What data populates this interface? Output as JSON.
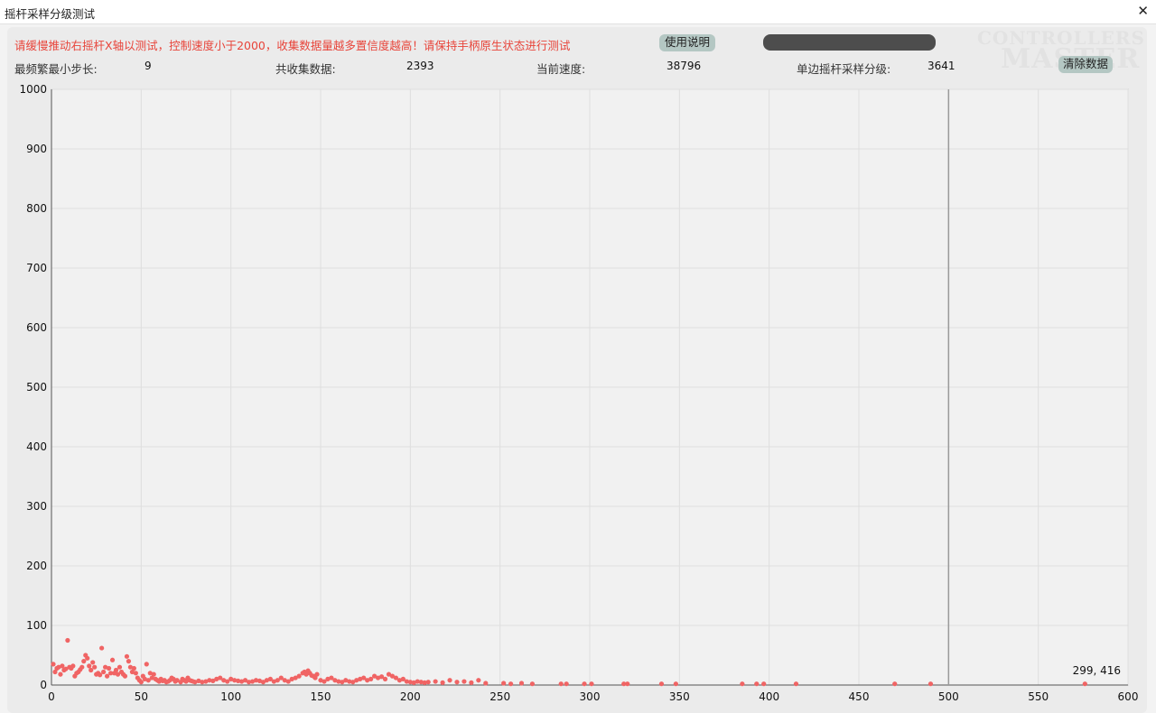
{
  "window": {
    "title": "摇杆采样分级测试",
    "close_glyph": "✕"
  },
  "header": {
    "instruction": "请缓慢推动右摇杆X轴以测试，控制速度小于2000，收集数据量越多置信度越高！请保持手柄原生状态进行测试",
    "help_label": "使用说明",
    "clear_label": "清除数据"
  },
  "stats": {
    "min_step_label": "最频繁最小步长:",
    "min_step_value": "9",
    "collected_label": "共收集数据:",
    "collected_value": "2393",
    "speed_label": "当前速度:",
    "speed_value": "38796",
    "levels_label": "单边摇杆采样分级:",
    "levels_value": "3641"
  },
  "watermark": {
    "line1": "CONTROLLERS",
    "line2": "MASTER"
  },
  "colors": {
    "points": "#f06464",
    "marker_line": "#9a9a9a",
    "grid": "#dedede",
    "plot_bg": "#f1f1f1"
  },
  "chart_data": {
    "type": "scatter",
    "xlim": [
      0,
      600
    ],
    "ylim": [
      0,
      1000
    ],
    "x_ticks": [
      0,
      50,
      100,
      150,
      200,
      250,
      300,
      350,
      400,
      450,
      500,
      550,
      600
    ],
    "y_ticks": [
      0,
      100,
      200,
      300,
      400,
      500,
      600,
      700,
      800,
      900,
      1000
    ],
    "marker_x": 500,
    "hover_label": "299, 416",
    "grid": true,
    "points": [
      [
        1,
        35
      ],
      [
        2,
        22
      ],
      [
        3,
        28
      ],
      [
        4,
        30
      ],
      [
        5,
        18
      ],
      [
        6,
        32
      ],
      [
        7,
        25
      ],
      [
        8,
        27
      ],
      [
        9,
        75
      ],
      [
        10,
        30
      ],
      [
        11,
        28
      ],
      [
        12,
        32
      ],
      [
        13,
        15
      ],
      [
        14,
        20
      ],
      [
        15,
        22
      ],
      [
        16,
        26
      ],
      [
        17,
        30
      ],
      [
        18,
        40
      ],
      [
        19,
        50
      ],
      [
        20,
        45
      ],
      [
        21,
        32
      ],
      [
        22,
        25
      ],
      [
        23,
        38
      ],
      [
        24,
        30
      ],
      [
        25,
        18
      ],
      [
        26,
        20
      ],
      [
        27,
        17
      ],
      [
        28,
        62
      ],
      [
        29,
        22
      ],
      [
        30,
        30
      ],
      [
        31,
        15
      ],
      [
        32,
        28
      ],
      [
        33,
        20
      ],
      [
        34,
        42
      ],
      [
        35,
        20
      ],
      [
        36,
        25
      ],
      [
        37,
        18
      ],
      [
        38,
        30
      ],
      [
        39,
        22
      ],
      [
        40,
        18
      ],
      [
        41,
        15
      ],
      [
        42,
        48
      ],
      [
        43,
        40
      ],
      [
        44,
        30
      ],
      [
        45,
        22
      ],
      [
        46,
        28
      ],
      [
        47,
        20
      ],
      [
        48,
        12
      ],
      [
        49,
        8
      ],
      [
        50,
        5
      ],
      [
        51,
        15
      ],
      [
        52,
        10
      ],
      [
        53,
        35
      ],
      [
        54,
        8
      ],
      [
        55,
        20
      ],
      [
        56,
        12
      ],
      [
        57,
        18
      ],
      [
        58,
        10
      ],
      [
        59,
        8
      ],
      [
        60,
        6
      ],
      [
        61,
        10
      ],
      [
        62,
        7
      ],
      [
        63,
        8
      ],
      [
        64,
        5
      ],
      [
        65,
        6
      ],
      [
        66,
        8
      ],
      [
        67,
        12
      ],
      [
        68,
        10
      ],
      [
        69,
        6
      ],
      [
        70,
        8
      ],
      [
        72,
        5
      ],
      [
        73,
        10
      ],
      [
        74,
        8
      ],
      [
        75,
        6
      ],
      [
        76,
        12
      ],
      [
        77,
        8
      ],
      [
        78,
        7
      ],
      [
        79,
        6
      ],
      [
        80,
        5
      ],
      [
        82,
        7
      ],
      [
        84,
        5
      ],
      [
        86,
        6
      ],
      [
        88,
        8
      ],
      [
        90,
        7
      ],
      [
        92,
        10
      ],
      [
        94,
        12
      ],
      [
        96,
        8
      ],
      [
        98,
        6
      ],
      [
        100,
        10
      ],
      [
        102,
        8
      ],
      [
        104,
        7
      ],
      [
        106,
        6
      ],
      [
        108,
        8
      ],
      [
        110,
        5
      ],
      [
        112,
        6
      ],
      [
        114,
        8
      ],
      [
        116,
        7
      ],
      [
        118,
        5
      ],
      [
        120,
        8
      ],
      [
        122,
        10
      ],
      [
        124,
        6
      ],
      [
        126,
        8
      ],
      [
        128,
        12
      ],
      [
        130,
        8
      ],
      [
        132,
        6
      ],
      [
        134,
        10
      ],
      [
        136,
        12
      ],
      [
        138,
        15
      ],
      [
        140,
        20
      ],
      [
        141,
        22
      ],
      [
        142,
        18
      ],
      [
        143,
        24
      ],
      [
        144,
        20
      ],
      [
        145,
        16
      ],
      [
        146,
        15
      ],
      [
        147,
        12
      ],
      [
        148,
        18
      ],
      [
        150,
        8
      ],
      [
        152,
        6
      ],
      [
        154,
        10
      ],
      [
        156,
        12
      ],
      [
        158,
        8
      ],
      [
        160,
        6
      ],
      [
        162,
        5
      ],
      [
        164,
        8
      ],
      [
        166,
        6
      ],
      [
        168,
        5
      ],
      [
        170,
        8
      ],
      [
        172,
        10
      ],
      [
        174,
        12
      ],
      [
        176,
        8
      ],
      [
        178,
        10
      ],
      [
        180,
        15
      ],
      [
        182,
        12
      ],
      [
        184,
        14
      ],
      [
        186,
        10
      ],
      [
        188,
        18
      ],
      [
        190,
        15
      ],
      [
        192,
        12
      ],
      [
        194,
        8
      ],
      [
        196,
        10
      ],
      [
        198,
        6
      ],
      [
        200,
        5
      ],
      [
        202,
        4
      ],
      [
        204,
        6
      ],
      [
        206,
        5
      ],
      [
        208,
        4
      ],
      [
        210,
        5
      ],
      [
        214,
        6
      ],
      [
        218,
        4
      ],
      [
        222,
        8
      ],
      [
        226,
        5
      ],
      [
        230,
        6
      ],
      [
        234,
        4
      ],
      [
        238,
        8
      ],
      [
        242,
        3
      ],
      [
        252,
        3
      ],
      [
        256,
        2
      ],
      [
        262,
        3
      ],
      [
        268,
        2
      ],
      [
        284,
        2
      ],
      [
        287,
        2
      ],
      [
        297,
        2
      ],
      [
        301,
        2
      ],
      [
        319,
        2
      ],
      [
        321,
        2
      ],
      [
        340,
        2
      ],
      [
        348,
        2
      ],
      [
        385,
        2
      ],
      [
        393,
        2
      ],
      [
        397,
        2
      ],
      [
        415,
        2
      ],
      [
        470,
        2
      ],
      [
        490,
        2
      ],
      [
        576,
        2
      ]
    ]
  }
}
